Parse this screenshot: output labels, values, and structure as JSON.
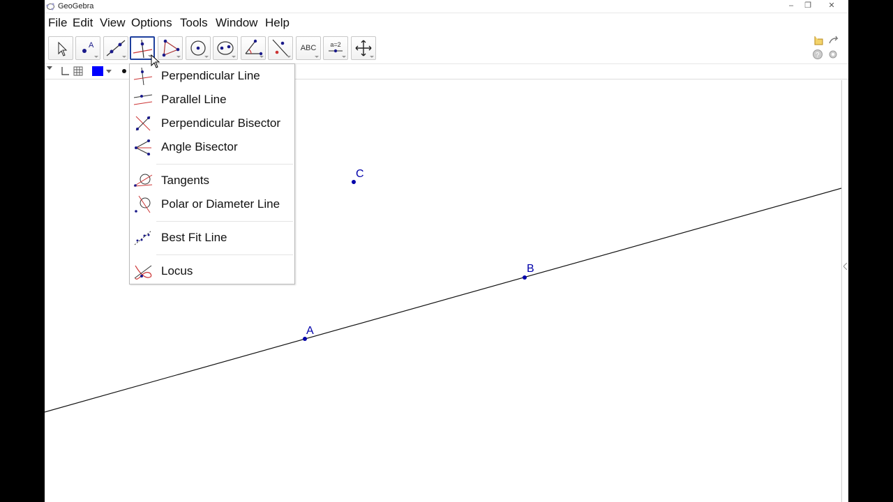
{
  "window": {
    "title": "GeoGebra",
    "buttons": [
      "–",
      "❐",
      "✕"
    ]
  },
  "menubar": [
    "File",
    "Edit",
    "View",
    "Options",
    "Tools",
    "Window",
    "Help"
  ],
  "toolbar": {
    "tools": [
      {
        "name": "move-tool",
        "active": false
      },
      {
        "name": "point-tool",
        "active": false
      },
      {
        "name": "line-tool",
        "active": false
      },
      {
        "name": "perpendicular-line-tool",
        "active": true
      },
      {
        "name": "polygon-tool",
        "active": false
      },
      {
        "name": "circle-tool",
        "active": false
      },
      {
        "name": "ellipse-tool",
        "active": false
      },
      {
        "name": "angle-tool",
        "active": false
      },
      {
        "name": "reflect-tool",
        "active": false
      },
      {
        "name": "text-tool",
        "active": false,
        "label": "ABC"
      },
      {
        "name": "slider-tool",
        "active": false,
        "label": "a=2"
      },
      {
        "name": "move-graphics-tool",
        "active": false
      }
    ],
    "right_icons": [
      "undo-icon",
      "redo-icon",
      "help-icon",
      "settings-icon"
    ]
  },
  "dropdown": {
    "items": [
      {
        "label": "Perpendicular Line",
        "icon": "perpendicular-line-icon"
      },
      {
        "label": "Parallel Line",
        "icon": "parallel-line-icon"
      },
      {
        "label": "Perpendicular Bisector",
        "icon": "perpendicular-bisector-icon"
      },
      {
        "label": "Angle Bisector",
        "icon": "angle-bisector-icon"
      },
      {
        "label": "Tangents",
        "icon": "tangents-icon"
      },
      {
        "label": "Polar or Diameter Line",
        "icon": "polar-line-icon"
      },
      {
        "label": "Best Fit Line",
        "icon": "best-fit-line-icon"
      },
      {
        "label": "Locus",
        "icon": "locus-icon"
      }
    ]
  },
  "graphics": {
    "points": [
      {
        "label": "A"
      },
      {
        "label": "B"
      },
      {
        "label": "C"
      }
    ],
    "colors": {
      "point": "#0000aa",
      "line": "#111111",
      "active_tool_border": "#1d3f9d"
    }
  }
}
